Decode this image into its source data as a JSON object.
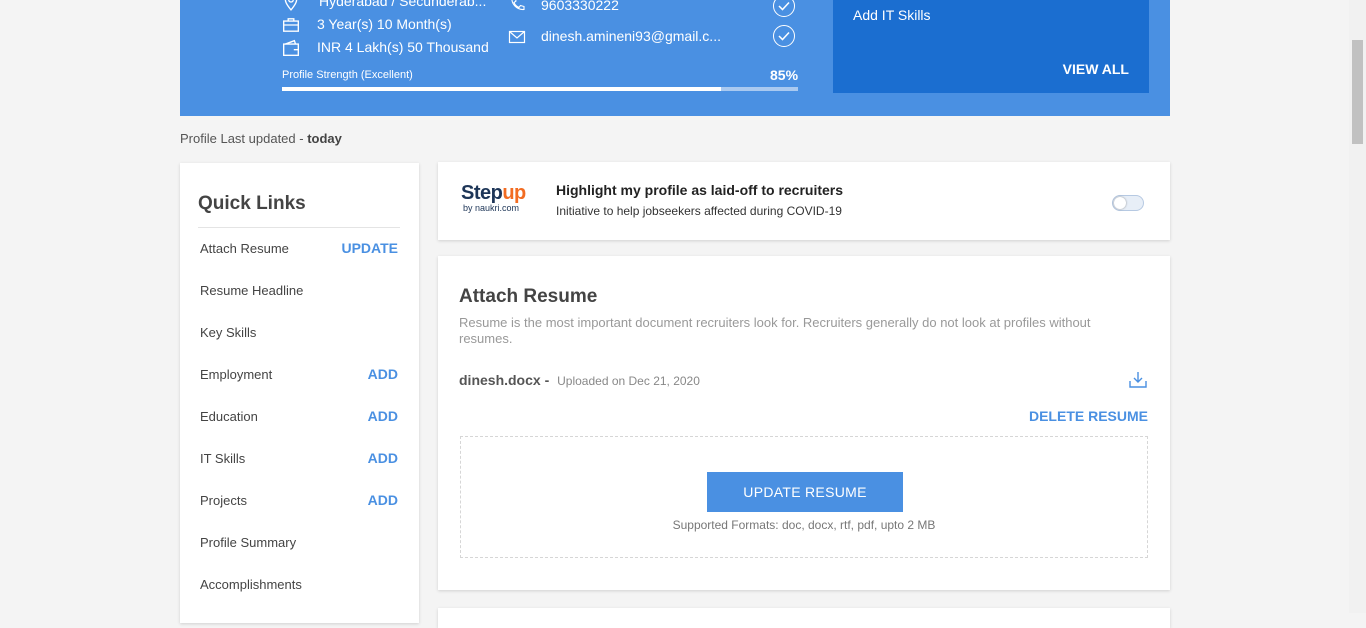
{
  "banner": {
    "location": "Hyderabad / Secunderab...",
    "experience": "3 Year(s) 10 Month(s)",
    "salary": "INR 4 Lakh(s) 50 Thousand",
    "phone": "9603330222",
    "email": "dinesh.amineni93@gmail.c...",
    "strength_label": "Profile Strength (Excellent)",
    "strength_value": "85%",
    "strength_fraction": 0.85,
    "pending_item": "Add IT Skills",
    "view_all": "VIEW ALL"
  },
  "last_updated": {
    "prefix": "Profile Last updated - ",
    "value": "today"
  },
  "quick_links": {
    "title": "Quick Links",
    "items": [
      {
        "label": "Attach Resume",
        "action": "UPDATE"
      },
      {
        "label": "Resume Headline",
        "action": ""
      },
      {
        "label": "Key Skills",
        "action": ""
      },
      {
        "label": "Employment",
        "action": "ADD"
      },
      {
        "label": "Education",
        "action": "ADD"
      },
      {
        "label": "IT Skills",
        "action": "ADD"
      },
      {
        "label": "Projects",
        "action": "ADD"
      },
      {
        "label": "Profile Summary",
        "action": ""
      },
      {
        "label": "Accomplishments",
        "action": ""
      }
    ]
  },
  "stepup": {
    "logo_main": "Step",
    "logo_up": "up",
    "logo_sub": "by naukri.com",
    "title": "Highlight my profile as laid-off to recruiters",
    "subtitle": "Initiative to help jobseekers affected during COVID-19",
    "toggle_on": false
  },
  "resume": {
    "title": "Attach Resume",
    "description": "Resume is the most important document recruiters look for. Recruiters generally do not look at profiles without resumes.",
    "file_name": "dinesh.docx -",
    "uploaded": "Uploaded on Dec 21, 2020",
    "delete_label": "DELETE RESUME",
    "update_label": "UPDATE RESUME",
    "formats": "Supported Formats: doc, docx, rtf, pdf, upto 2 MB"
  },
  "colors": {
    "banner": "#4a90e2",
    "pending_box": "#1b6ed0",
    "accent": "#4a90e2"
  }
}
